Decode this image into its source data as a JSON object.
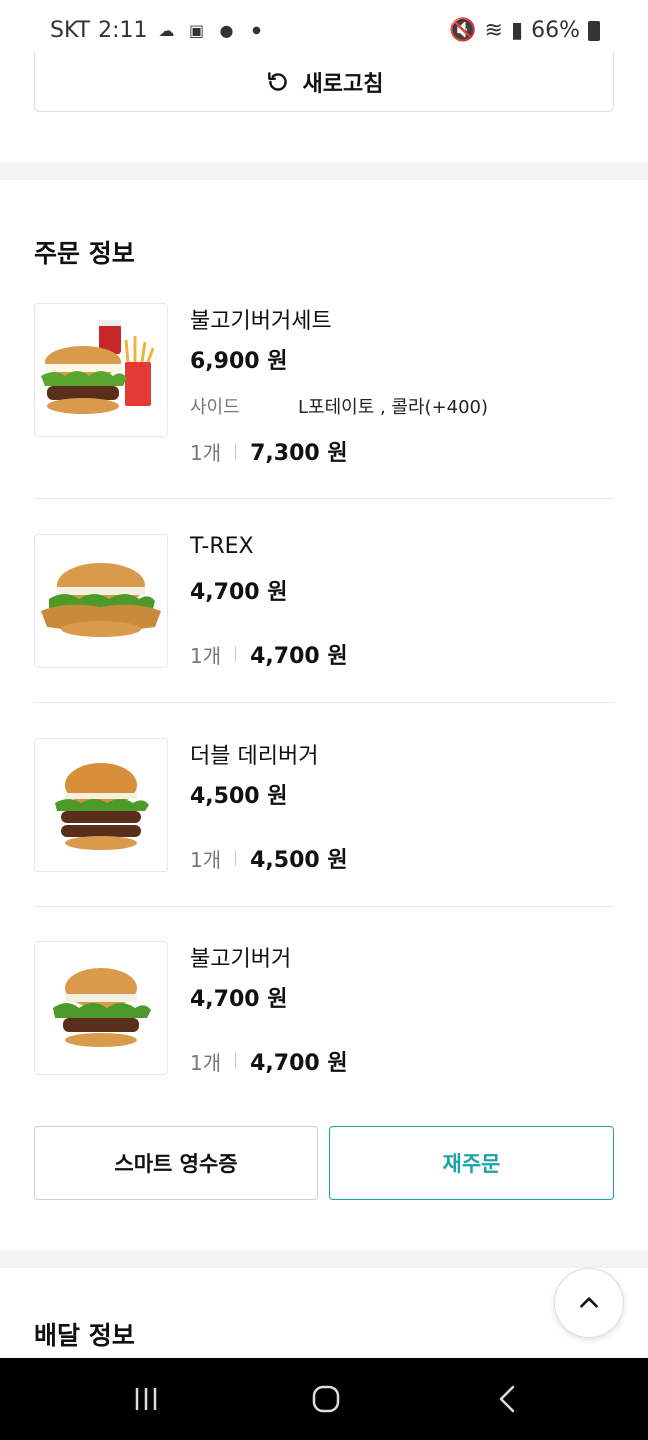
{
  "status_bar": {
    "carrier": "SKT",
    "time": "2:11",
    "notification_icons": [
      "cloud-sync-icon",
      "gallery-icon",
      "talk-icon",
      "dot-icon"
    ],
    "system_icons": [
      "mute-icon",
      "wifi-icon",
      "signal-icon",
      "battery-icon"
    ],
    "battery": "66%"
  },
  "refresh": {
    "label": "새로고침",
    "icon": "refresh-icon"
  },
  "order_info": {
    "title": "주문 정보",
    "items": [
      {
        "name": "불고기버거세트",
        "price": "6,900 원",
        "option_label": "사이드",
        "option_value": "L포테이토 , 콜라(+400)",
        "qty": "1개",
        "total": "7,300 원"
      },
      {
        "name": "T-REX",
        "price": "4,700 원",
        "qty": "1개",
        "total": "4,700 원"
      },
      {
        "name": "더블 데리버거",
        "price": "4,500 원",
        "qty": "1개",
        "total": "4,500 원"
      },
      {
        "name": "불고기버거",
        "price": "4,700 원",
        "qty": "1개",
        "total": "4,700 원"
      }
    ],
    "receipt_button": "스마트 영수증",
    "reorder_button": "재주문"
  },
  "delivery_info": {
    "title": "배달 정보"
  },
  "colors": {
    "accent": "#1aa3a8",
    "divider": "#f3f3f3",
    "text": "#111111",
    "muted": "#777777"
  }
}
